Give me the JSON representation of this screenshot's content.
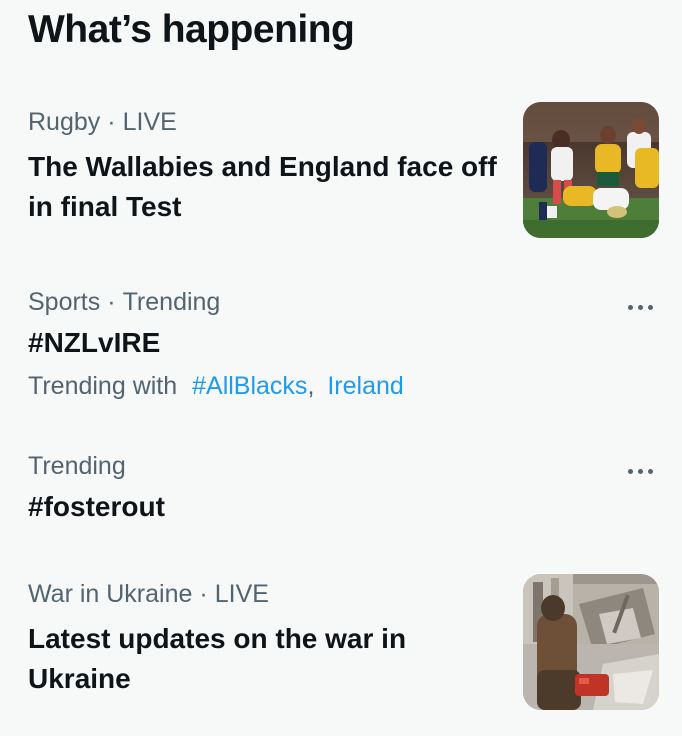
{
  "section": {
    "title": "What’s happening"
  },
  "trends": [
    {
      "category": "Rugby",
      "status": "LIVE",
      "headline": "The Wallabies and England face off in final Test",
      "thumbnail": "rugby-match-photo"
    },
    {
      "category": "Sports",
      "status": "Trending",
      "headline": "#NZLvIRE",
      "trending_with_label": "Trending with",
      "related": [
        "#AllBlacks",
        "Ireland"
      ],
      "separator": ",",
      "more_icon": "more-horizontal-icon"
    },
    {
      "category": "Trending",
      "headline": "#fosterout",
      "more_icon": "more-horizontal-icon"
    },
    {
      "category": "War in Ukraine",
      "status": "LIVE",
      "headline": "Latest updates on the war in Ukraine",
      "thumbnail": "war-ukraine-photo"
    }
  ],
  "colors": {
    "background": "#f7f9f9",
    "text_primary": "#0f1419",
    "text_secondary": "#536471",
    "link": "#1d9bf0"
  }
}
